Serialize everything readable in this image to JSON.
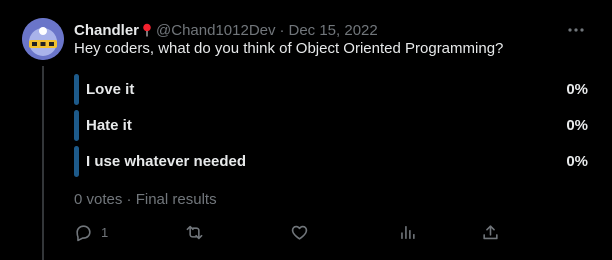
{
  "tweet": {
    "name": "Chandler",
    "handle": "@Chand1012Dev",
    "separator": "·",
    "date": "Dec 15, 2022",
    "text": "Hey coders, what do you think of Object Oriented Programming?"
  },
  "poll": {
    "options": [
      {
        "label": "Love it",
        "percent": "0%"
      },
      {
        "label": "Hate it",
        "percent": "0%"
      },
      {
        "label": "I use whatever needed",
        "percent": "0%"
      }
    ],
    "votes": "0 votes",
    "separator": "·",
    "status": "Final results",
    "bar_color": "#1d5a8a"
  },
  "actions": {
    "reply_count": "1",
    "icons": [
      "reply-icon",
      "retweet-icon",
      "like-icon",
      "views-icon",
      "share-icon"
    ]
  },
  "colors": {
    "background": "#000000",
    "text": "#e7e9ea",
    "muted": "#71767b",
    "pin": "#f4212e"
  }
}
